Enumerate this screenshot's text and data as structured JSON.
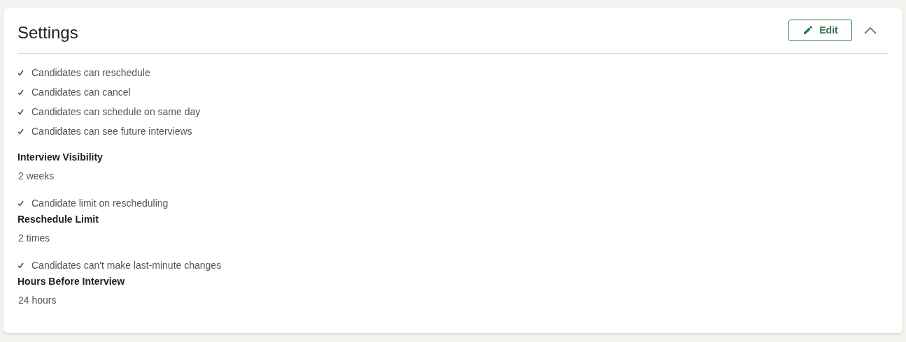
{
  "panel": {
    "title": "Settings",
    "edit_button": "Edit",
    "expanded": true
  },
  "items": [
    {
      "kind": "check",
      "label": "Candidates can reschedule",
      "checked": true
    },
    {
      "kind": "check",
      "label": "Candidates can cancel",
      "checked": true
    },
    {
      "kind": "check",
      "label": "Candidates can schedule on same day",
      "checked": true
    },
    {
      "kind": "check",
      "label": "Candidates can see future interviews",
      "checked": true
    },
    {
      "kind": "field",
      "label": "Interview Visibility",
      "value": "2 weeks"
    },
    {
      "kind": "check",
      "label": "Candidate limit on rescheduling",
      "checked": true
    },
    {
      "kind": "field",
      "label": "Reschedule Limit",
      "value": "2 times"
    },
    {
      "kind": "check",
      "label": "Candidates can't make last-minute changes",
      "checked": true
    },
    {
      "kind": "field",
      "label": "Hours Before Interview",
      "value": "24 hours"
    }
  ]
}
